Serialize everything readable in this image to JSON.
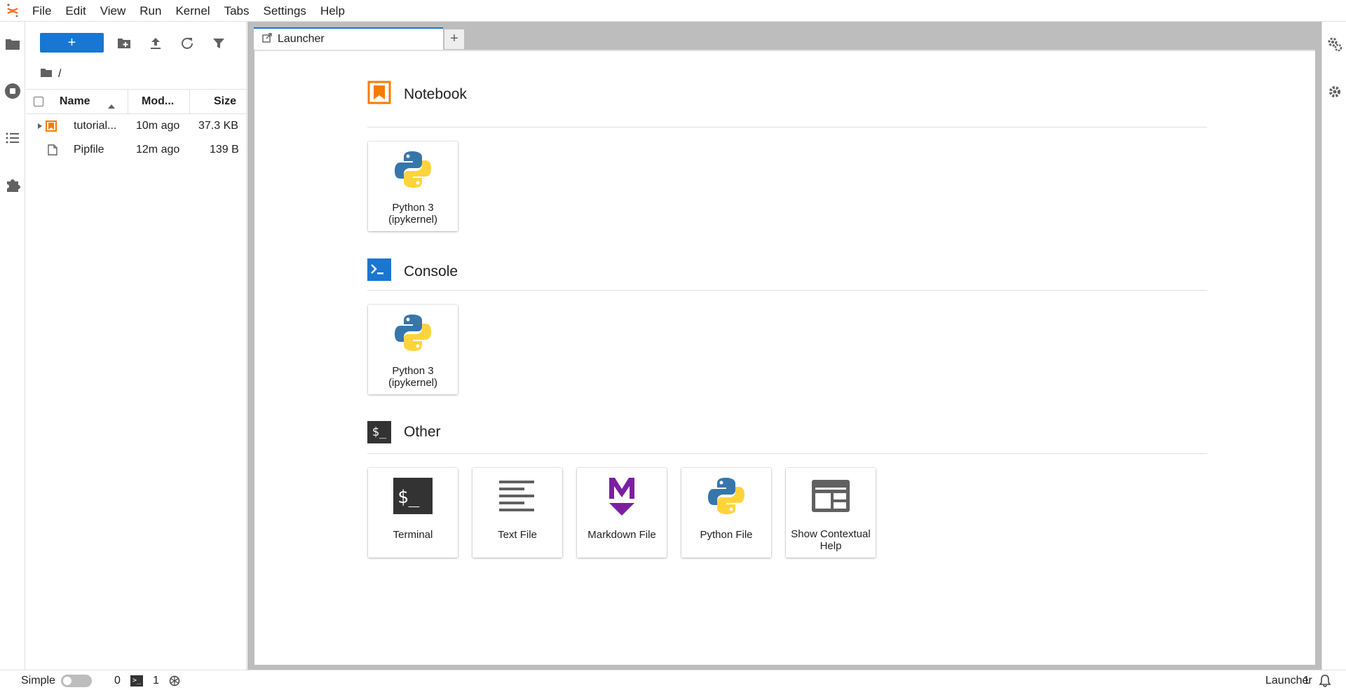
{
  "menu": {
    "items": [
      "File",
      "Edit",
      "View",
      "Run",
      "Kernel",
      "Tabs",
      "Settings",
      "Help"
    ]
  },
  "filebrowser": {
    "new_label": "+",
    "path": "/",
    "columns": {
      "name": "Name",
      "modified": "Mod...",
      "size": "Size"
    },
    "files": [
      {
        "name": "tutorial...",
        "modified": "10m ago",
        "size": "37.3 KB",
        "icon": "notebook-icon"
      },
      {
        "name": "Pipfile",
        "modified": "12m ago",
        "size": "139 B",
        "icon": "file-icon"
      }
    ]
  },
  "tabs": {
    "active_label": "Launcher",
    "add_label": "+"
  },
  "launcher": {
    "notebook": {
      "title": "Notebook",
      "cards": [
        {
          "line1": "Python 3",
          "line2": "(ipykernel)"
        }
      ]
    },
    "console": {
      "title": "Console",
      "cards": [
        {
          "line1": "Python 3",
          "line2": "(ipykernel)"
        }
      ]
    },
    "other": {
      "title": "Other",
      "icon_text": "$_",
      "cards": [
        {
          "label": "Terminal",
          "icon": "terminal-icon"
        },
        {
          "label": "Text File",
          "icon": "text-file-icon"
        },
        {
          "label": "Markdown File",
          "icon": "markdown-icon"
        },
        {
          "label": "Python File",
          "icon": "python-icon"
        },
        {
          "line1": "Show Contextual",
          "line2": "Help",
          "icon": "contextual-help-icon"
        }
      ]
    }
  },
  "statusbar": {
    "mode_label": "Simple",
    "kernels_count": "0",
    "terminals_count": "1",
    "active_doc": "Launcher",
    "notifications_count": "1"
  },
  "colors": {
    "accent": "#1976d2",
    "notebook_orange": "#f57c00",
    "markdown_purple": "#7b1fa2",
    "python_blue": "#3776ab",
    "python_yellow": "#ffd43b"
  }
}
